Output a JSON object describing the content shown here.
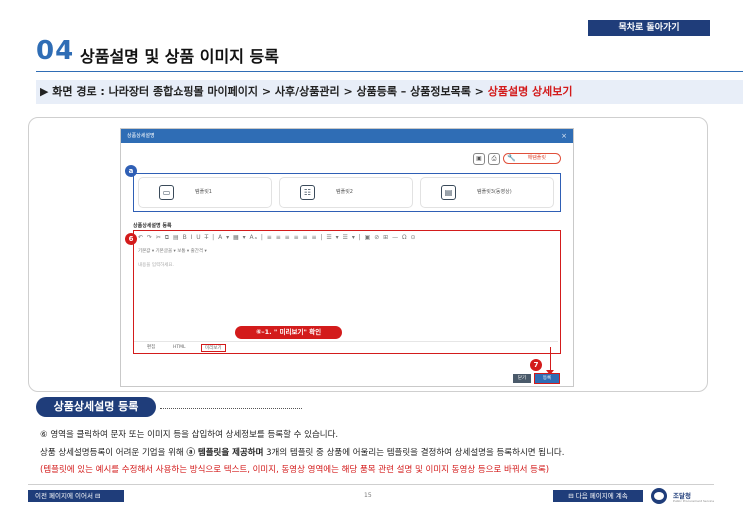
{
  "header": {
    "toc_button": "목차로 돌아가기",
    "section_number": "04",
    "section_title": "상품설명 및 상품 이미지 등록"
  },
  "path": {
    "prefix": "▶ 화면 경로 :",
    "trail": "나라장터 종합쇼핑몰 마이페이지 > 사후/상품관리 > 상품등록 – 상품정보목록 >",
    "current": "상품설명 상세보기"
  },
  "dialog": {
    "title": "상품상세설명",
    "close": "×",
    "template_button": "해템플릿",
    "templates": [
      {
        "label": "템플릿1",
        "icon": "monitor-icon"
      },
      {
        "label": "템플릿2",
        "icon": "layout-icon"
      },
      {
        "label": "템플릿3(동영상)",
        "icon": "clipboard-icon"
      }
    ],
    "editor_label": "상품상세설명 등록",
    "toolbar_main": "↶ ↷ ✂ ⧉ ▤  B  I  U  T̶  |  A  ▾  ▦  ▾  Aₐ  |  ≡  ≡  ≡  ≡  ≡  ≡  |  ☰  ▾  ☰  ▾  |  ▣  ⊘  ⊞  —  Ω  ⊙",
    "toolbar_font": "기본값   ▾  기본글꼴       ▾  보통     ▾  줄간격  ▾",
    "placeholder": "내용을 입력하세요.",
    "tabs": [
      "편집",
      "HTML",
      "미리보기"
    ],
    "callout": "⑥–1. \" 미리보기\"  확인",
    "buttons": {
      "close": "닫기",
      "register": "등록"
    },
    "badges": {
      "a": "a",
      "six": "6",
      "seven": "7"
    }
  },
  "summary": {
    "title": "상품상세설명 등록",
    "line1": "⑥ 영역을 클릭하여 문자 또는 이미지 등을 삽입하여 상세정보를 등록할 수 있습니다.",
    "line2_pre": "상품 상세설명등록이 어려운 기업을 위해",
    "line2_bold": "ⓐ 템플릿을 제공하며",
    "line2_post": "3개의 템플릿 중 상품에 어울리는 템플릿을 결정하여 상세설명을 등록하시면 됩니다.",
    "line3": "(템플릿에 있는 예시를 수정해서 사용하는 방식으로 텍스트, 이미지, 동영상 영역에는 해당 품목 관련 설명 및 이미지 동영상 등으로 바꿔서 등록)"
  },
  "footer": {
    "prev": "이전 페이지에 이어서 ⊟",
    "next": "⊟ 다음 페이지에 계속",
    "page": "15",
    "logo": "조달청",
    "logo_sub": "Public Procurement Service"
  },
  "colors": {
    "navy": "#1f3d7a",
    "blue": "#2f6db5",
    "red": "#d31b1b",
    "dialog_header": "#2f6db5"
  }
}
